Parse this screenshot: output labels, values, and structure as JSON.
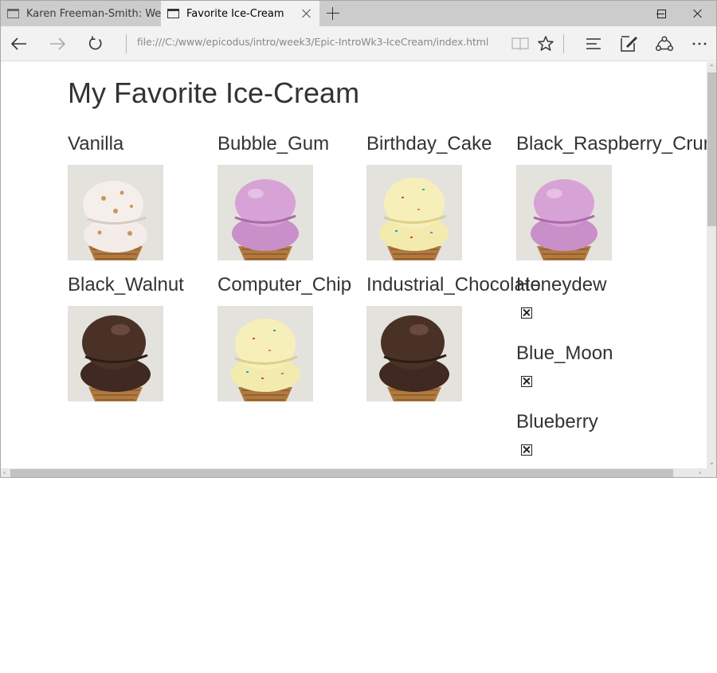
{
  "browser": {
    "tabs": [
      {
        "title": "Karen Freeman-Smith: Web",
        "active": false
      },
      {
        "title": "Favorite Ice-Cream",
        "active": true
      }
    ],
    "address": "file:///C:/www/epicodus/intro/week3/Epic-IntroWk3-IceCream/index.html"
  },
  "page": {
    "title": "My Favorite Ice-Cream",
    "flavors": [
      {
        "name": "Vanilla",
        "image": "vanilla-cone"
      },
      {
        "name": "Bubble_Gum",
        "image": "pink-cone"
      },
      {
        "name": "Birthday_Cake",
        "image": "sprinkle-cone"
      },
      {
        "name": "Black_Raspberry_Crunch",
        "image": "pink-cone"
      },
      {
        "name": "Black_Walnut",
        "image": "chocolate-cone"
      },
      {
        "name": "Computer_Chip",
        "image": "sprinkle-cone"
      },
      {
        "name": "Industrial_Chocolate",
        "image": "chocolate-cone"
      },
      {
        "name": "Honeydew",
        "image": "broken-image"
      },
      {
        "name": "Blue_Moon",
        "image": "broken-image"
      },
      {
        "name": "Blueberry",
        "image": "broken-image"
      }
    ]
  },
  "colors": {
    "vanilla": "#f3ece8",
    "bubble_gum": "#c98fc8",
    "birthday_cake": "#f7efba",
    "chocolate": "#4a3126",
    "cone": "#b07a40",
    "background": "#e4e2dd"
  }
}
